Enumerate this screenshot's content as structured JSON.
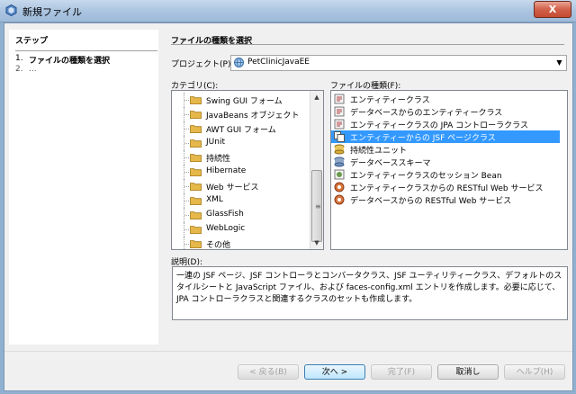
{
  "window": {
    "title": "新規ファイル",
    "close_symbol": "X"
  },
  "steps": {
    "title": "ステップ",
    "items": [
      {
        "num": "1.",
        "label": "ファイルの種類を選択"
      },
      {
        "num": "2.",
        "label": "..."
      }
    ]
  },
  "main": {
    "title": "ファイルの種類を選択",
    "project_label": "プロジェクト(P):",
    "project_value": "PetClinicJavaEE",
    "categories_label": "カテゴリ(C):",
    "filetypes_label": "ファイルの種類(F):",
    "description_label": "説明(D):"
  },
  "categories": [
    {
      "label": "Swing GUI フォーム"
    },
    {
      "label": "JavaBeans オブジェクト"
    },
    {
      "label": "AWT GUI フォーム"
    },
    {
      "label": "JUnit"
    },
    {
      "label": "持続性"
    },
    {
      "label": "Hibernate"
    },
    {
      "label": "Web サービス"
    },
    {
      "label": "XML"
    },
    {
      "label": "GlassFish"
    },
    {
      "label": "WebLogic"
    },
    {
      "label": "その他"
    }
  ],
  "file_types": [
    {
      "label": "エンティティークラス",
      "icon": "entity-class-icon"
    },
    {
      "label": "データベースからのエンティティークラス",
      "icon": "entity-class-icon"
    },
    {
      "label": "エンティティークラスの JPA コントローラクラス",
      "icon": "entity-class-icon"
    },
    {
      "label": "エンティティーからの JSF ページクラス",
      "icon": "jsf-pages-icon",
      "selected": true
    },
    {
      "label": "持続性ユニット",
      "icon": "persistence-unit-icon"
    },
    {
      "label": "データベーススキーマ",
      "icon": "database-schema-icon"
    },
    {
      "label": "エンティティークラスのセッション Bean",
      "icon": "session-bean-icon"
    },
    {
      "label": "エンティティークラスからの RESTful Web サービス",
      "icon": "rest-service-icon"
    },
    {
      "label": "データベースからの RESTful Web サービス",
      "icon": "rest-service-icon"
    }
  ],
  "description": {
    "text": "一連の JSF ページ、JSF コントローラとコンバータクラス、JSF ユーティリティークラス、デフォルトのスタイルシートと JavaScript ファイル、および faces-config.xml エントリを作成します。必要に応じて、JPA コントローラクラスと関連するクラスのセットも作成します。"
  },
  "buttons": {
    "back": "< 戻る(B)",
    "next": "次へ >",
    "finish": "完了(F)",
    "cancel": "取消し",
    "help": "ヘルプ(H)"
  },
  "colors": {
    "selection": "#3399ff",
    "folder": "#e6b84a"
  }
}
